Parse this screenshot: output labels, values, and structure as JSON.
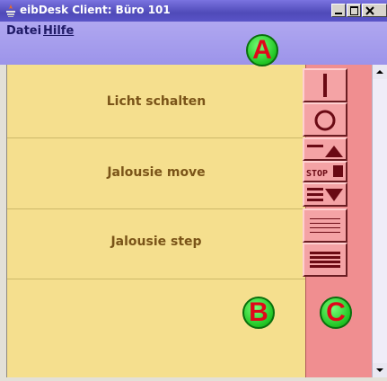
{
  "window": {
    "title": "eibDesk Client: Büro 101"
  },
  "menu": {
    "items": [
      "Datei",
      "Hilfe"
    ]
  },
  "rows": [
    {
      "label": "Licht schalten"
    },
    {
      "label": "Jalousie move"
    },
    {
      "label": "Jalousie step"
    },
    {
      "label": ""
    }
  ],
  "controls": {
    "stop_label": "STOP",
    "icons": [
      "on-icon",
      "off-icon",
      "jalousie-up-icon",
      "jalousie-stop-icon",
      "jalousie-down-icon",
      "jalousie-step-open-icon",
      "jalousie-step-close-icon"
    ]
  },
  "badges": {
    "a": "A",
    "b": "B",
    "c": "C"
  },
  "colors": {
    "row_bg": "#f5df8e",
    "control_bg": "#f08e90",
    "badge_green": "#20c423",
    "badge_text": "#e0071a",
    "title_bar": "#4f4ab8"
  }
}
